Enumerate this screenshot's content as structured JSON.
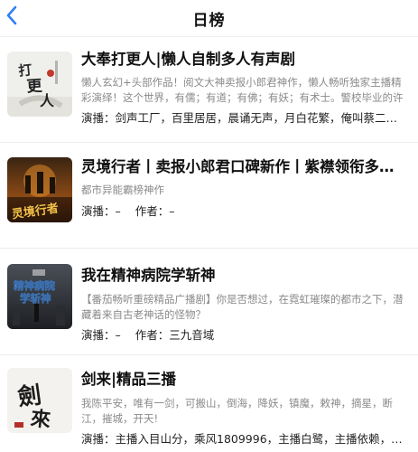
{
  "header": {
    "title": "日榜",
    "back_icon": "chevron-left-icon",
    "accent": "#2f7ff6"
  },
  "items": [
    {
      "title": "大奉打更人|懒人自制多人有声剧",
      "desc": "懒人玄幻+头部作品！阅文大神卖报小郎君神作，懒人畅听独家主播精彩演绎！这个世界，有儒；有道；有佛；有妖；有术士。警校毕业的许七…",
      "meta": "演播：剑声工厂，百里居居，晨诵无声，月白花繁，俺叫蔡二狗…",
      "cover_text": "打更人"
    },
    {
      "title": "灵境行者丨卖报小郎君口碑新作丨紫襟领衔多…",
      "desc": "都市异能霸榜神作",
      "narrator": "演播：–",
      "author": "作者：–",
      "cover_text": "灵境行者"
    },
    {
      "title": "我在精神病院学斩神",
      "desc": "【番茄畅听重磅精品广播剧】你是否想过，在霓虹璀璨的都市之下，潜藏着来自古老神话的怪物？",
      "narrator": "演播：–",
      "author": "作者：三九音域",
      "cover_text": "精神病院学斩神"
    },
    {
      "title": "剑来|精品三播",
      "desc": "我陈平安，唯有一剑，可搬山，倒海，降妖，镇魔，敕神，摘星，断江，摧城，开天!",
      "meta": "演播：主播入目山分，乘风1809996，主播白鹭，主播依赖，主…",
      "cover_text": "剑来"
    }
  ]
}
